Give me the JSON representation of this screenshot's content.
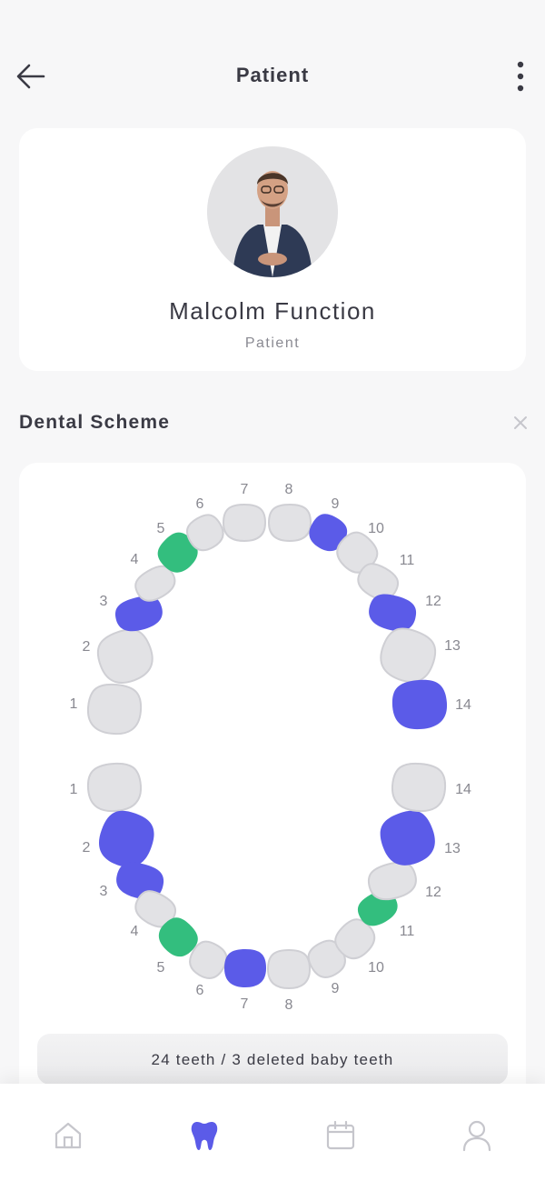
{
  "header": {
    "title": "Patient",
    "back_icon": "arrow-left-icon",
    "menu_icon": "more-vertical-icon"
  },
  "profile": {
    "name": "Malcolm Function",
    "role": "Patient"
  },
  "scheme": {
    "title": "Dental Scheme",
    "close_icon": "close-icon",
    "summary": "24 teeth / 3 deleted baby teeth",
    "colors": {
      "default": "#e2e2e5",
      "blue": "#5b5be8",
      "green": "#33be7e"
    },
    "upper": [
      {
        "n": 1,
        "state": "default"
      },
      {
        "n": 2,
        "state": "default"
      },
      {
        "n": 3,
        "state": "blue"
      },
      {
        "n": 4,
        "state": "default"
      },
      {
        "n": 5,
        "state": "green"
      },
      {
        "n": 6,
        "state": "default"
      },
      {
        "n": 7,
        "state": "default"
      },
      {
        "n": 8,
        "state": "default"
      },
      {
        "n": 9,
        "state": "blue"
      },
      {
        "n": 10,
        "state": "default"
      },
      {
        "n": 11,
        "state": "default"
      },
      {
        "n": 12,
        "state": "blue"
      },
      {
        "n": 13,
        "state": "default"
      },
      {
        "n": 14,
        "state": "blue"
      }
    ],
    "lower": [
      {
        "n": 1,
        "state": "default"
      },
      {
        "n": 2,
        "state": "blue"
      },
      {
        "n": 3,
        "state": "blue"
      },
      {
        "n": 4,
        "state": "default"
      },
      {
        "n": 5,
        "state": "green"
      },
      {
        "n": 6,
        "state": "default"
      },
      {
        "n": 7,
        "state": "blue"
      },
      {
        "n": 8,
        "state": "default"
      },
      {
        "n": 9,
        "state": "default"
      },
      {
        "n": 10,
        "state": "default"
      },
      {
        "n": 11,
        "state": "green"
      },
      {
        "n": 12,
        "state": "default"
      },
      {
        "n": 13,
        "state": "blue"
      },
      {
        "n": 14,
        "state": "default"
      }
    ]
  },
  "nav": [
    {
      "icon": "home-icon",
      "active": false
    },
    {
      "icon": "tooth-icon",
      "active": true
    },
    {
      "icon": "calendar-icon",
      "active": false
    },
    {
      "icon": "profile-icon",
      "active": false
    }
  ]
}
